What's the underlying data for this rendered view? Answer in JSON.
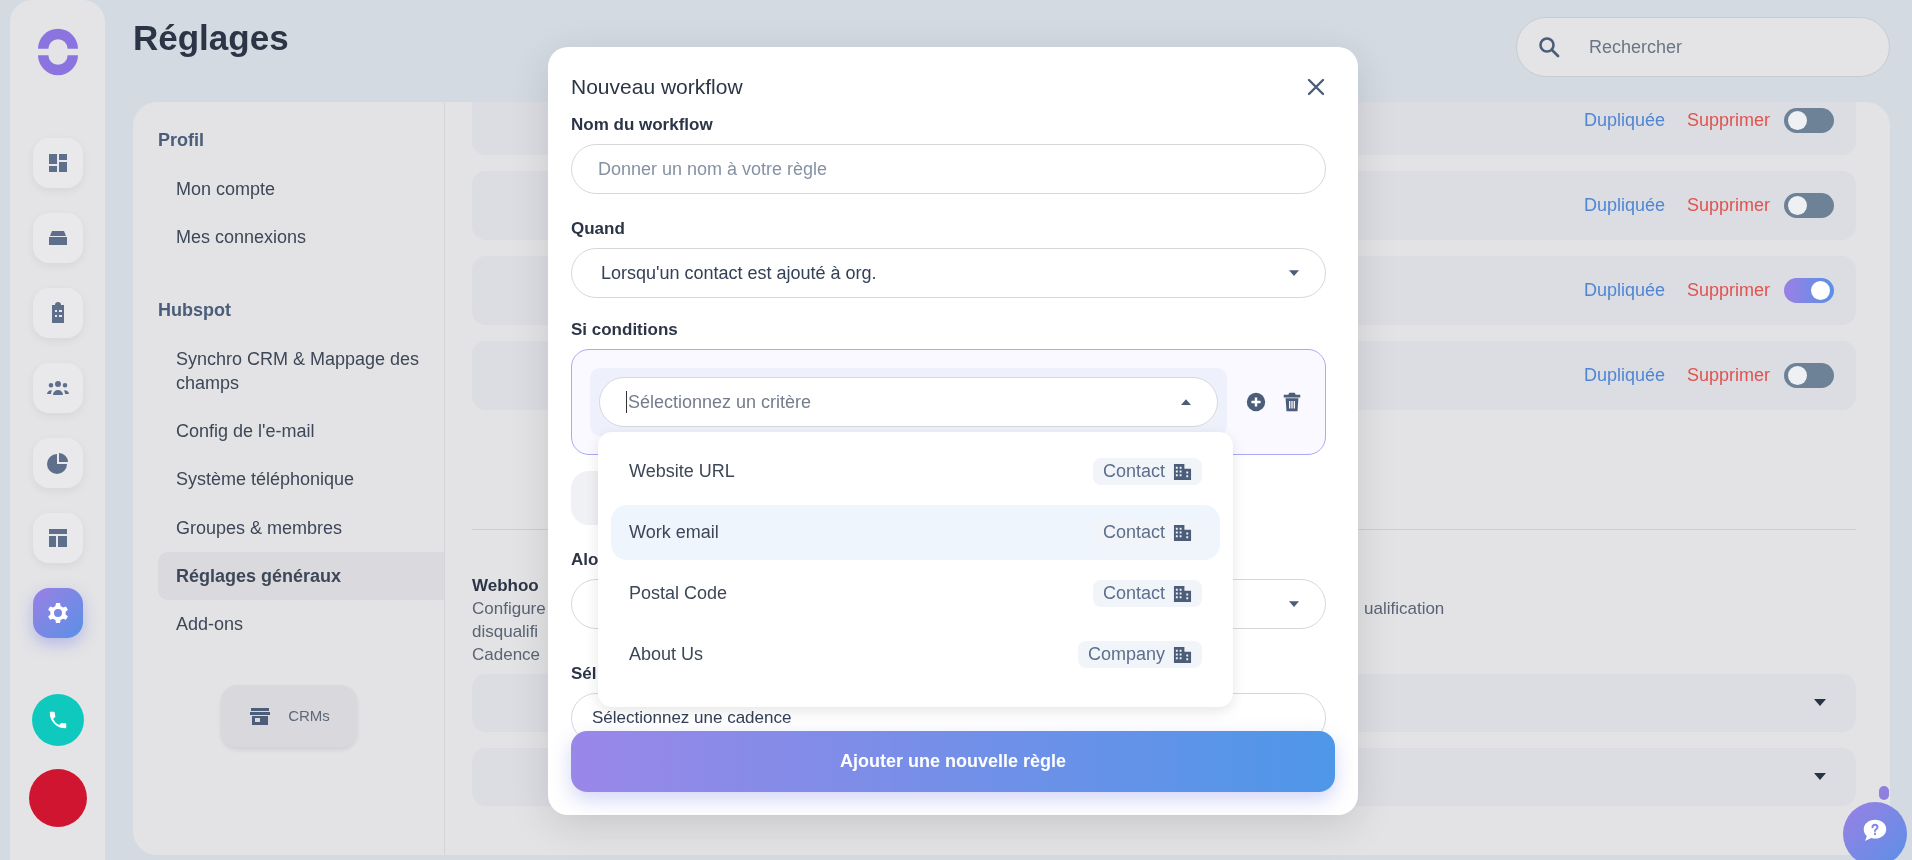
{
  "rail": {
    "items": [
      {
        "kind": "dashboard",
        "selected": false
      },
      {
        "kind": "inbox",
        "selected": false
      },
      {
        "kind": "tasks",
        "selected": false
      },
      {
        "kind": "team",
        "selected": false
      },
      {
        "kind": "reports",
        "selected": false
      },
      {
        "kind": "templates",
        "selected": false
      },
      {
        "kind": "settings",
        "selected": true
      }
    ]
  },
  "page": {
    "title": "Réglages",
    "search": {
      "placeholder": "Rechercher"
    }
  },
  "settings_menu": {
    "sections": [
      {
        "title": "Profil",
        "items": [
          {
            "label": "Mon compte",
            "selected": false
          },
          {
            "label": "Mes connexions",
            "selected": false
          }
        ]
      },
      {
        "title": "Hubspot",
        "items": [
          {
            "label": "Synchro CRM & Mappage des champs",
            "selected": false
          },
          {
            "label": "Config de l'e-mail",
            "selected": false
          },
          {
            "label": "Système téléphonique",
            "selected": false
          },
          {
            "label": "Groupes & membres",
            "selected": false
          },
          {
            "label": "Réglages généraux",
            "selected": true
          },
          {
            "label": "Add-ons",
            "selected": false
          }
        ]
      }
    ],
    "crm_button": "CRMs"
  },
  "workflows": [
    {
      "duplicate": "Dupliquée",
      "delete": "Supprimer",
      "on": false
    },
    {
      "duplicate": "Dupliquée",
      "delete": "Supprimer",
      "on": false
    },
    {
      "duplicate": "Dupliquée",
      "delete": "Supprimer",
      "on": true
    },
    {
      "duplicate": "Dupliquée",
      "delete": "Supprimer",
      "on": false
    }
  ],
  "webhook": {
    "title": "Webhoo",
    "description_left": [
      "Configure",
      "disqualifi",
      "Cadence"
    ],
    "description_right": "ualification"
  },
  "modal": {
    "title": "Nouveau workflow",
    "name_label": "Nom du workflow",
    "name_placeholder": "Donner un nom à votre règle",
    "when_label": "Quand",
    "when_value": "Lorsqu'un contact est ajouté à org.",
    "conditions_label": "Si conditions",
    "criterion_placeholder": "Sélectionnez un critère",
    "criteria": [
      {
        "label": "Website URL",
        "object": "Contact",
        "selected": false
      },
      {
        "label": "Work email",
        "object": "Contact",
        "selected": true
      },
      {
        "label": "Postal Code",
        "object": "Contact",
        "selected": false
      },
      {
        "label": "About Us",
        "object": "Company",
        "selected": false
      }
    ],
    "then_label": "Alo",
    "cadence_label": "Sél",
    "cadence_value": "Sélectionnez une cadence",
    "submit": "Ajouter une nouvelle règle"
  }
}
